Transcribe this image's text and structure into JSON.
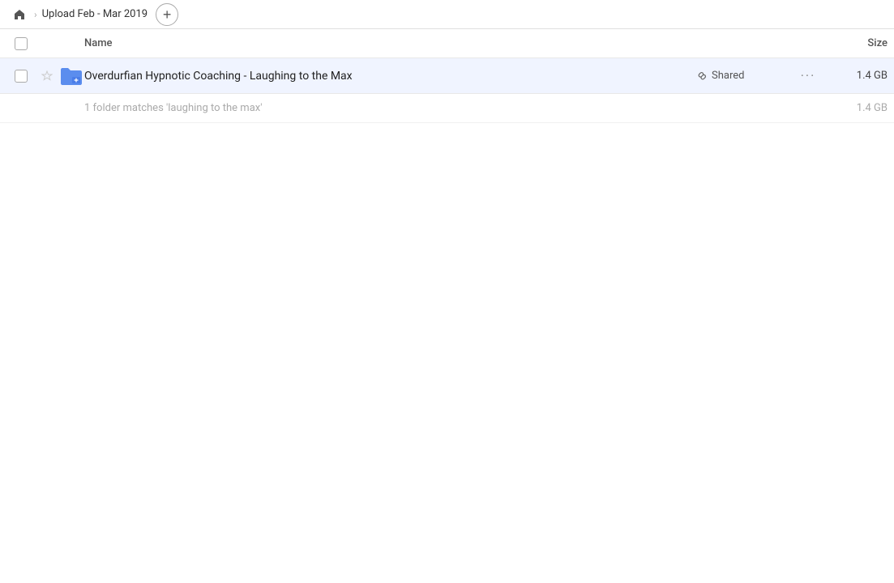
{
  "header": {
    "home_icon": "🏠",
    "breadcrumb_label": "Upload Feb - Mar 2019",
    "add_icon": "+",
    "chevron": "›"
  },
  "columns": {
    "name_label": "Name",
    "size_label": "Size"
  },
  "file_row": {
    "folder_name": "Overdurfian Hypnotic Coaching - Laughing to the Max",
    "shared_label": "Shared",
    "size": "1.4 GB",
    "more_icon": "···"
  },
  "summary": {
    "text": "1 folder matches 'laughing to the max'",
    "size": "1.4 GB"
  }
}
